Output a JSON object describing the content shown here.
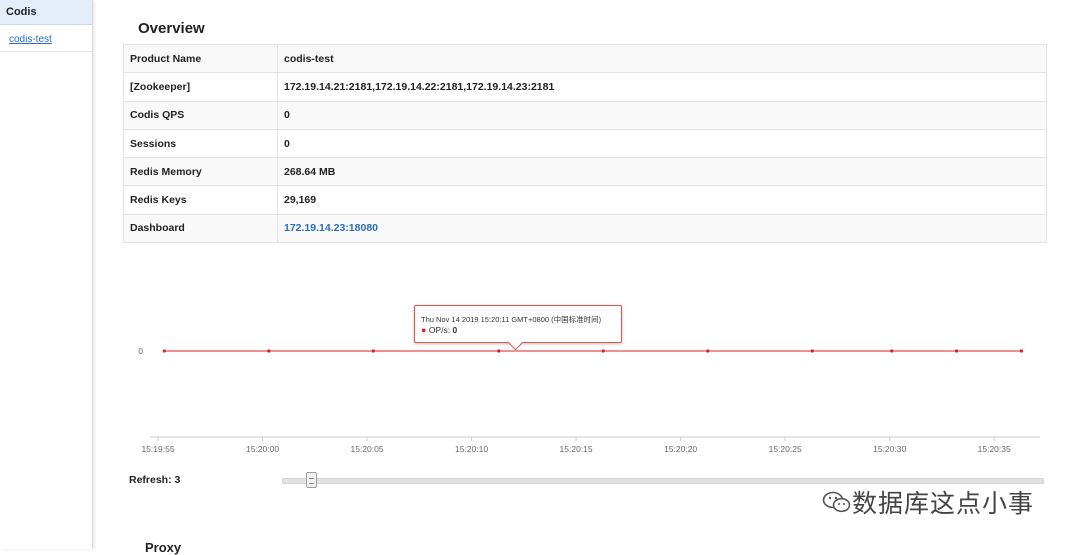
{
  "sidebar": {
    "header": "Codis",
    "items": [
      {
        "label": "codis-test"
      }
    ]
  },
  "overview": {
    "title": "Overview",
    "rows": [
      {
        "key": "Product Name",
        "value": "codis-test"
      },
      {
        "key": "[Zookeeper]",
        "value": "172.19.14.21:2181,172.19.14.22:2181,172.19.14.23:2181"
      },
      {
        "key": "Codis QPS",
        "value": "0"
      },
      {
        "key": "Sessions",
        "value": "0"
      },
      {
        "key": "Redis Memory",
        "value": "268.64 MB"
      },
      {
        "key": "Redis Keys",
        "value": "29,169"
      },
      {
        "key": "Dashboard",
        "value": "172.19.14.23:18080"
      }
    ]
  },
  "chart_data": {
    "type": "line",
    "series": [
      {
        "name": "OP/s",
        "values": [
          0,
          0,
          0,
          0,
          0,
          0,
          0,
          0,
          0,
          0
        ]
      }
    ],
    "y_tick_labels": [
      "0"
    ],
    "x_tick_labels": [
      "15:19:55",
      "15:20:00",
      "15:20:05",
      "15:20:10",
      "15:20:15",
      "15:20:20",
      "15:20:25",
      "15:20:30",
      "15:20:35"
    ],
    "x_ticks_sec": [
      0,
      5,
      10,
      15,
      20,
      25,
      30,
      35,
      40
    ],
    "x_points_sec": [
      0.3,
      5.3,
      10.3,
      16.3,
      21.3,
      26.3,
      31.3,
      35.1,
      38.2,
      41.3
    ],
    "x_range_sec": [
      0,
      42
    ],
    "color": "#d9202a",
    "tooltip": {
      "time": "Thu Nov 14 2019 15:20:11 GMT+0800 (中国标准时间)",
      "label": "OP/s:",
      "value": "0"
    }
  },
  "refresh": {
    "label": "Refresh: 3",
    "value": 3
  },
  "watermark": {
    "text": "数据库这点小事"
  },
  "proxy": {
    "title": "Proxy"
  }
}
